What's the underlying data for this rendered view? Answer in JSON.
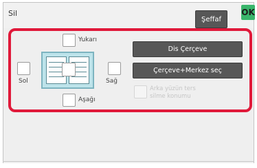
{
  "header": {
    "title": "Sil",
    "transparent_label": "Şeffaf",
    "ok_label": "OK"
  },
  "positions": {
    "top_label": "Yukarı",
    "left_label": "Sol",
    "right_label": "Sağ",
    "bottom_label": "Aşağı"
  },
  "buttons": {
    "frame_label": "Dis Çerçeve",
    "frame_center_label": "Çerçeve+Merkez seç"
  },
  "back_side": {
    "line1": "Arka yüzün ters",
    "line2": "silme konumu"
  },
  "colors": {
    "ok": "#3ab56b",
    "highlight": "#e0193a",
    "button": "#575757"
  }
}
